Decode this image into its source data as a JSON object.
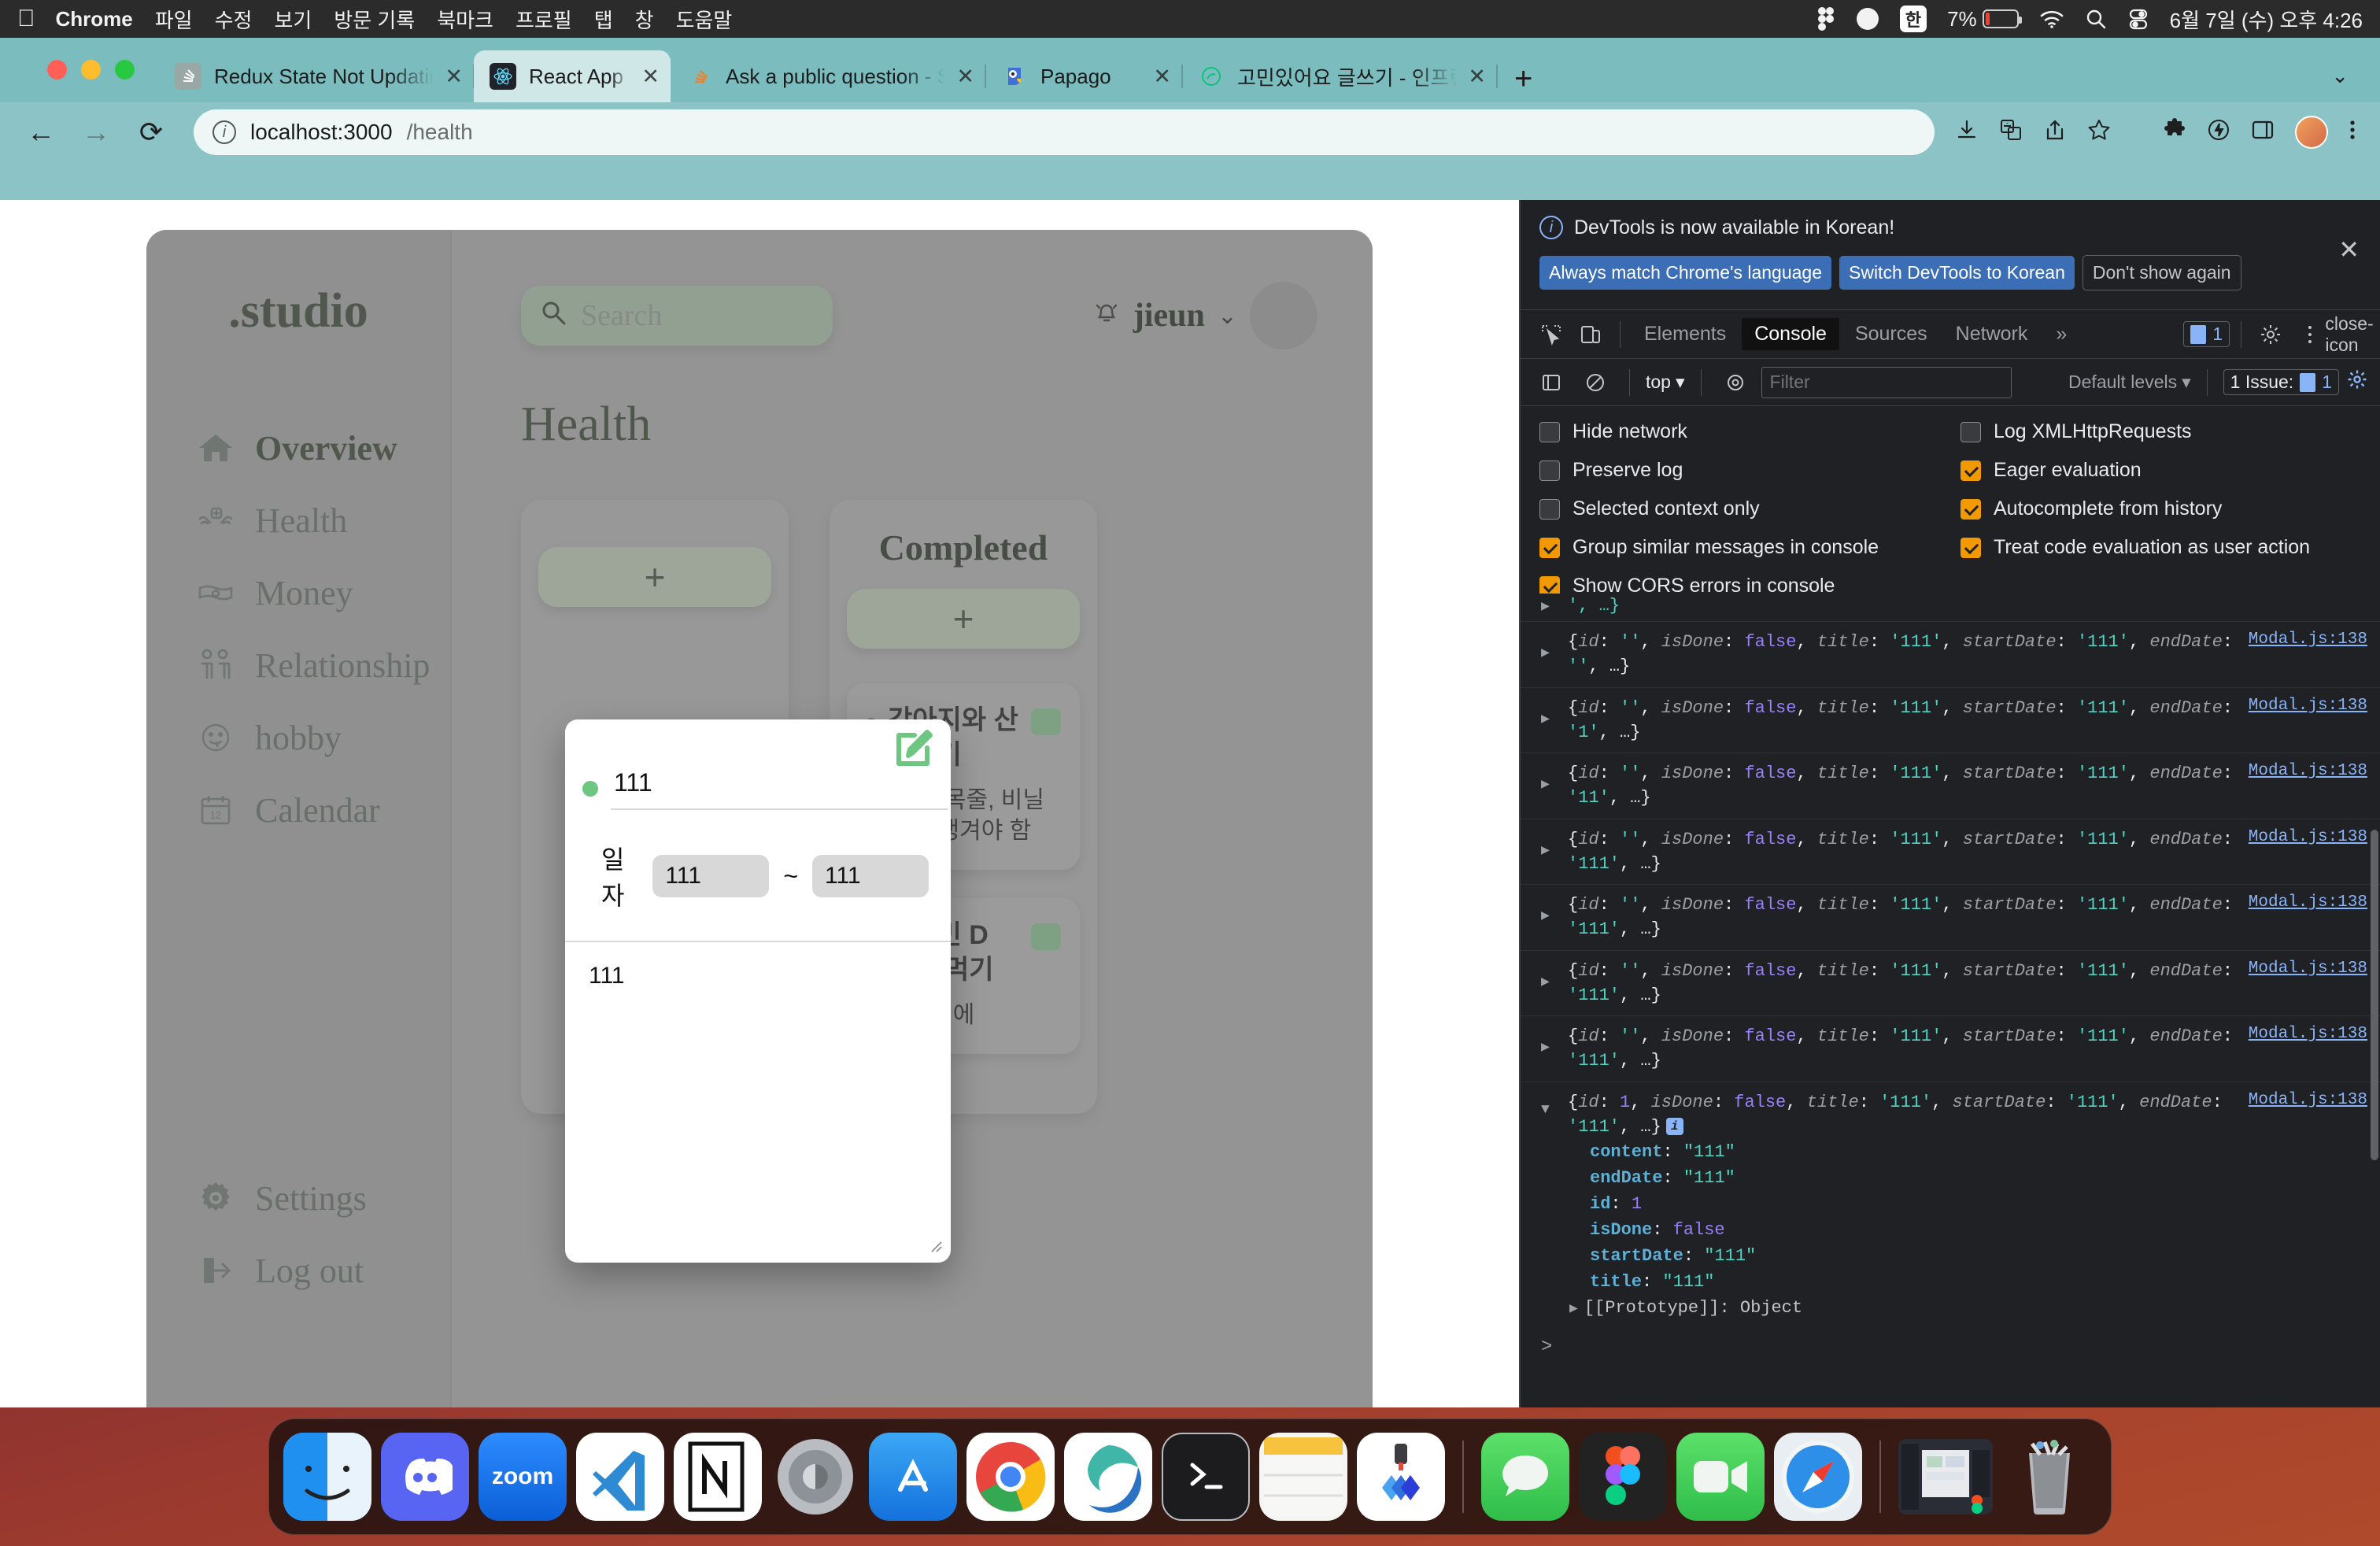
{
  "menubar": {
    "apple_icon": "apple-logo",
    "app_name": "Chrome",
    "items": [
      "파일",
      "수정",
      "보기",
      "방문 기록",
      "북마크",
      "프로필",
      "탭",
      "창",
      "도움말"
    ],
    "status": {
      "figma_icon": "figma-icon",
      "arc_icon": "arc-icon",
      "input_source": "한",
      "battery_percent": "7%",
      "wifi_icon": "wifi-icon",
      "search_icon": "spotlight-search-icon",
      "control_center_icon": "control-center-icon",
      "clock": "6월 7일 (수) 오후 4:26"
    }
  },
  "browser": {
    "tabs": [
      {
        "title": "Redux State Not Updating",
        "favicon": "stackoverflow-gray-icon",
        "active": false,
        "close": "✕"
      },
      {
        "title": "React App",
        "favicon": "react-icon",
        "active": true,
        "close": "✕"
      },
      {
        "title": "Ask a public question - Stack O",
        "favicon": "stackoverflow-icon",
        "active": false,
        "close": "✕"
      },
      {
        "title": "Papago",
        "favicon": "papago-icon",
        "active": false,
        "close": "✕"
      },
      {
        "title": "고민있어요 글쓰기 - 인프런 | 커뮤니티",
        "favicon": "inflearn-icon",
        "active": false,
        "close": "✕"
      }
    ],
    "new_tab_label": "+",
    "tabstrip_overflow": "⌄",
    "toolbar": {
      "back": "←",
      "forward": "→",
      "reload": "⟳",
      "site_info_icon": "info-circle-icon",
      "url_host": "localhost:3000",
      "url_path": "/health",
      "download_icon": "download-icon",
      "translate_icon": "translate-icon",
      "share_icon": "share-icon",
      "bookmark_icon": "star-icon",
      "extensions_icon": "puzzle-icon",
      "flash_icon": "lightning-icon",
      "sidepanel_icon": "side-panel-icon",
      "profile_icon": "profile-avatar",
      "menu_icon": "kebab-menu-icon"
    }
  },
  "app": {
    "brand": ".studio",
    "sidebar": {
      "items": [
        {
          "label": "Overview",
          "icon": "home-icon",
          "active": true
        },
        {
          "label": "Health",
          "icon": "health-hands-icon",
          "active": false
        },
        {
          "label": "Money",
          "icon": "money-bill-icon",
          "active": false
        },
        {
          "label": "Relationship",
          "icon": "people-icon",
          "active": false
        },
        {
          "label": "hobby",
          "icon": "smiley-icon",
          "active": false
        },
        {
          "label": "Calendar",
          "icon": "calendar-icon",
          "active": false
        }
      ],
      "bottom_items": [
        {
          "label": "Settings",
          "icon": "gear-icon"
        },
        {
          "label": "Log out",
          "icon": "logout-icon"
        }
      ]
    },
    "topbar": {
      "search_placeholder": "Search",
      "search_icon": "search-icon",
      "bell_icon": "bell-icon",
      "username": "jieun",
      "caret": "⌄",
      "avatar": "user-avatar"
    },
    "page_title": "Health",
    "columns": [
      {
        "title": "",
        "add_label": "+",
        "tasks": []
      },
      {
        "title": "Completed",
        "add_label": "+",
        "tasks": [
          {
            "title": "강아지와 산책하기",
            "body": "물병, 목줄, 비닐봉투 챙겨야 함",
            "done": true
          },
          {
            "title": "비타민 D 챙겨 먹기",
            "body": "협탁위에",
            "done": true
          }
        ]
      }
    ]
  },
  "modal": {
    "edit_icon": "edit-pencil-icon",
    "status_dot": "green-status-dot",
    "title_value": "111",
    "date_label": "일자",
    "start_date": "111",
    "range_sep": "~",
    "end_date": "111",
    "content_value": "111",
    "resize_grip": "resize-grip-icon"
  },
  "devtools": {
    "banner": {
      "info_icon": "info-circle-icon",
      "message": "DevTools is now available in Korean!",
      "buttons": [
        {
          "label": "Always match Chrome's language",
          "primary": true
        },
        {
          "label": "Switch DevTools to Korean",
          "primary": true
        },
        {
          "label": "Don't show again",
          "primary": false
        }
      ],
      "close": "✕"
    },
    "toolbar": {
      "inspect_icon": "inspect-element-icon",
      "device_icon": "device-toolbar-icon",
      "tabs": [
        {
          "label": "Elements",
          "active": false
        },
        {
          "label": "Console",
          "active": true
        },
        {
          "label": "Sources",
          "active": false
        },
        {
          "label": "Network",
          "active": false
        }
      ],
      "overflow": "»",
      "issues_count": "1",
      "settings_icon": "gear-icon",
      "more_icon": "kebab-menu-icon",
      "close_icon": "close-icon"
    },
    "filterbar": {
      "sidebar_icon": "show-console-sidebar-icon",
      "clear_icon": "clear-console-icon",
      "context": "top",
      "context_caret": "▾",
      "eye_icon": "live-expression-icon",
      "filter_placeholder": "Filter",
      "levels": "Default levels",
      "levels_caret": "▾",
      "issues_label": "1 Issue:",
      "issues_value": "1",
      "settings_icon": "console-settings-gear-icon"
    },
    "settings": [
      {
        "label": "Hide network",
        "checked": false
      },
      {
        "label": "Log XMLHttpRequests",
        "checked": false
      },
      {
        "label": "Preserve log",
        "checked": false
      },
      {
        "label": "Eager evaluation",
        "checked": true
      },
      {
        "label": "Selected context only",
        "checked": false
      },
      {
        "label": "Autocomplete from history",
        "checked": true
      },
      {
        "label": "Group similar messages in console",
        "checked": true
      },
      {
        "label": "Treat code evaluation as user action",
        "checked": true
      },
      {
        "label": "Show CORS errors in console",
        "checked": true
      }
    ],
    "console_logs": [
      {
        "truncated_top": true,
        "text": "', …}",
        "source": ""
      },
      {
        "id": "''",
        "isDone": "false",
        "title": "'111'",
        "startDate": "'111'",
        "endDate": "''",
        "tail": ", …}",
        "source": "Modal.js:138"
      },
      {
        "id": "''",
        "isDone": "false",
        "title": "'111'",
        "startDate": "'111'",
        "endDate": "'1'",
        "tail": ", …}",
        "source": "Modal.js:138"
      },
      {
        "id": "''",
        "isDone": "false",
        "title": "'111'",
        "startDate": "'111'",
        "endDate": "'11'",
        "tail": ", …}",
        "source": "Modal.js:138"
      },
      {
        "id": "''",
        "isDone": "false",
        "title": "'111'",
        "startDate": "'111'",
        "endDate": "'111'",
        "tail": ", …}",
        "source": "Modal.js:138"
      },
      {
        "id": "''",
        "isDone": "false",
        "title": "'111'",
        "startDate": "'111'",
        "endDate": "'111'",
        "tail": ", …}",
        "source": "Modal.js:138"
      },
      {
        "id": "''",
        "isDone": "false",
        "title": "'111'",
        "startDate": "'111'",
        "endDate": "'111'",
        "tail": ", …}",
        "source": "Modal.js:138"
      },
      {
        "id": "''",
        "isDone": "false",
        "title": "'111'",
        "startDate": "'111'",
        "endDate": "'111'",
        "tail": ", …}",
        "source": "Modal.js:138"
      }
    ],
    "expanded_log": {
      "source": "Modal.js:138",
      "summary_id": "1",
      "summary_isDone": "false",
      "summary_title": "'111'",
      "summary_startDate": "'111'",
      "summary_endDate": "'111'",
      "summary_tail": ", …}",
      "info_badge": "i",
      "properties": [
        {
          "key": "content",
          "value": "\"111\"",
          "type": "string"
        },
        {
          "key": "endDate",
          "value": "\"111\"",
          "type": "string"
        },
        {
          "key": "id",
          "value": "1",
          "type": "number"
        },
        {
          "key": "isDone",
          "value": "false",
          "type": "boolean"
        },
        {
          "key": "startDate",
          "value": "\"111\"",
          "type": "string"
        },
        {
          "key": "title",
          "value": "\"111\"",
          "type": "string"
        }
      ],
      "prototype": "[[Prototype]]: Object"
    },
    "prompt": ">"
  },
  "dock": {
    "apps": [
      {
        "name": "Finder",
        "icon": "finder-icon",
        "running": true
      },
      {
        "name": "Discord",
        "icon": "discord-icon",
        "running": true
      },
      {
        "name": "Zoom",
        "icon": "zoom-icon",
        "running": false
      },
      {
        "name": "Visual Studio Code",
        "icon": "vscode-icon",
        "running": true
      },
      {
        "name": "Notion",
        "icon": "notion-icon",
        "running": true
      },
      {
        "name": "System Settings",
        "icon": "system-settings-icon",
        "running": false
      },
      {
        "name": "App Store",
        "icon": "app-store-icon",
        "running": false
      },
      {
        "name": "Google Chrome",
        "icon": "chrome-icon",
        "running": true
      },
      {
        "name": "Microsoft Edge",
        "icon": "edge-icon",
        "running": true
      },
      {
        "name": "Terminal",
        "icon": "terminal-icon",
        "running": true
      },
      {
        "name": "Notes",
        "icon": "notes-icon",
        "running": true
      },
      {
        "name": "Sketch",
        "icon": "sketch-icon",
        "running": false
      },
      {
        "name": "Messages",
        "icon": "messages-icon",
        "running": true
      },
      {
        "name": "Figma",
        "icon": "figma-icon",
        "running": true
      },
      {
        "name": "FaceTime",
        "icon": "facetime-icon",
        "running": false
      },
      {
        "name": "Safari",
        "icon": "safari-icon",
        "running": true
      },
      {
        "name": "Minimized Window",
        "icon": "minimized-window-thumb",
        "running": false
      },
      {
        "name": "Trash",
        "icon": "trash-icon",
        "running": false
      }
    ]
  }
}
